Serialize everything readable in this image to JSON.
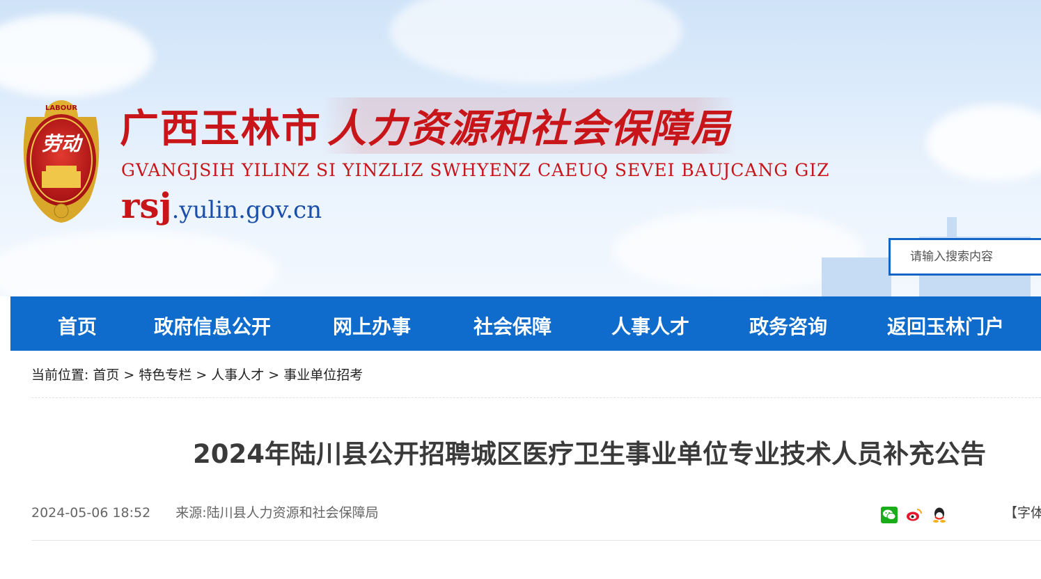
{
  "header": {
    "title_cn_part1": "广西玉林市",
    "title_cn_part2": "人力资源和社会保障局",
    "title_en": "GVANGJSIH YILINZ SI YINZLIZ SWHYENZ CAEUQ SEVEI BAUJCANG GIZ",
    "domain_part1": "rsj",
    "domain_part2": ".yulin.gov.cn",
    "emblem_text_top": "LABOUR",
    "emblem_text_center": "劳动",
    "search_placeholder": "请输入搜索内容"
  },
  "nav": {
    "items": [
      "首页",
      "政府信息公开",
      "网上办事",
      "社会保障",
      "人事人才",
      "政务咨询",
      "返回玉林门户"
    ]
  },
  "breadcrumb": {
    "prefix": "当前位置:",
    "items": [
      "首页",
      "特色专栏",
      "人事人才",
      "事业单位招考"
    ],
    "separator": ">"
  },
  "article": {
    "title": "2024年陆川县公开招聘城区医疗卫生事业单位专业技术人员补充公告",
    "date": "2024-05-06 18:52",
    "source": "来源:陆川县人力资源和社会保障局",
    "fontsize_label": "【字体"
  },
  "share": {
    "icons": [
      "wechat-icon",
      "weibo-icon",
      "qq-icon"
    ]
  },
  "colors": {
    "brand_red": "#c8151a",
    "nav_blue": "#0f6ccd",
    "domain_blue": "#1a4ea8"
  }
}
